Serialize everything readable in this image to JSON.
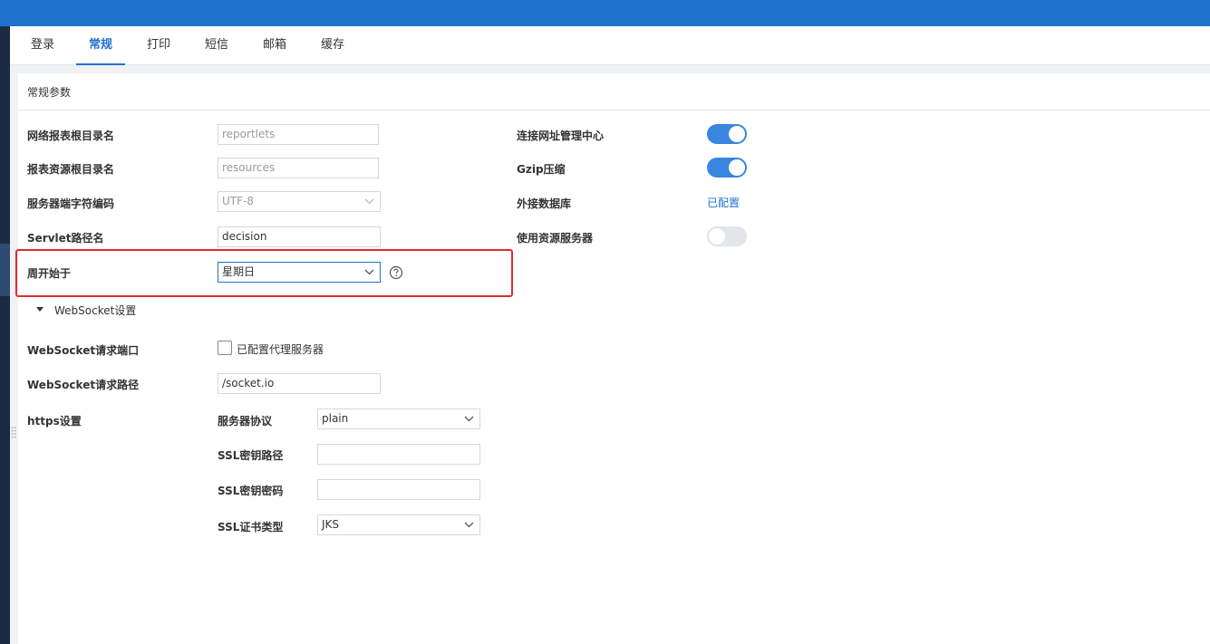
{
  "tabs": [
    "登录",
    "常规",
    "打印",
    "短信",
    "邮箱",
    "缓存"
  ],
  "section_title": "常规参数",
  "fields": {
    "report_root_label": "网络报表根目录名",
    "report_root_value": "reportlets",
    "resource_root_label": "报表资源根目录名",
    "resource_root_value": "resources",
    "encoding_label": "服务器端字符编码",
    "encoding_value": "UTF-8",
    "servlet_label": "Servlet路径名",
    "servlet_value": "decision",
    "week_start_label": "周开始于",
    "week_start_value": "星期日"
  },
  "right": {
    "url_center_label": "连接网址管理中心",
    "gzip_label": "Gzip压缩",
    "ext_db_label": "外接数据库",
    "ext_db_link": "已配置",
    "res_server_label": "使用资源服务器"
  },
  "toggles": {
    "url_center": true,
    "gzip": true,
    "res_server": false
  },
  "websocket": {
    "title": "WebSocket设置",
    "port_label": "WebSocket请求端口",
    "proxy_checkbox_label": "已配置代理服务器",
    "proxy_checked": false,
    "path_label": "WebSocket请求路径",
    "path_value": "/socket.io"
  },
  "https": {
    "label": "https设置",
    "protocol_label": "服务器协议",
    "protocol_value": "plain",
    "ssl_key_path_label": "SSL密钥路径",
    "ssl_key_path_value": "",
    "ssl_key_pwd_label": "SSL密钥密码",
    "ssl_key_pwd_value": "",
    "ssl_cert_type_label": "SSL证书类型",
    "ssl_cert_type_value": "JKS"
  },
  "icons": {
    "dropdown": "chevron-down-icon",
    "help": "question-circle-icon",
    "expand": "caret-down-icon"
  },
  "colors": {
    "accent": "#1f72cc",
    "toggle_on": "#3a85e0",
    "highlight_border": "#e02d2d"
  }
}
